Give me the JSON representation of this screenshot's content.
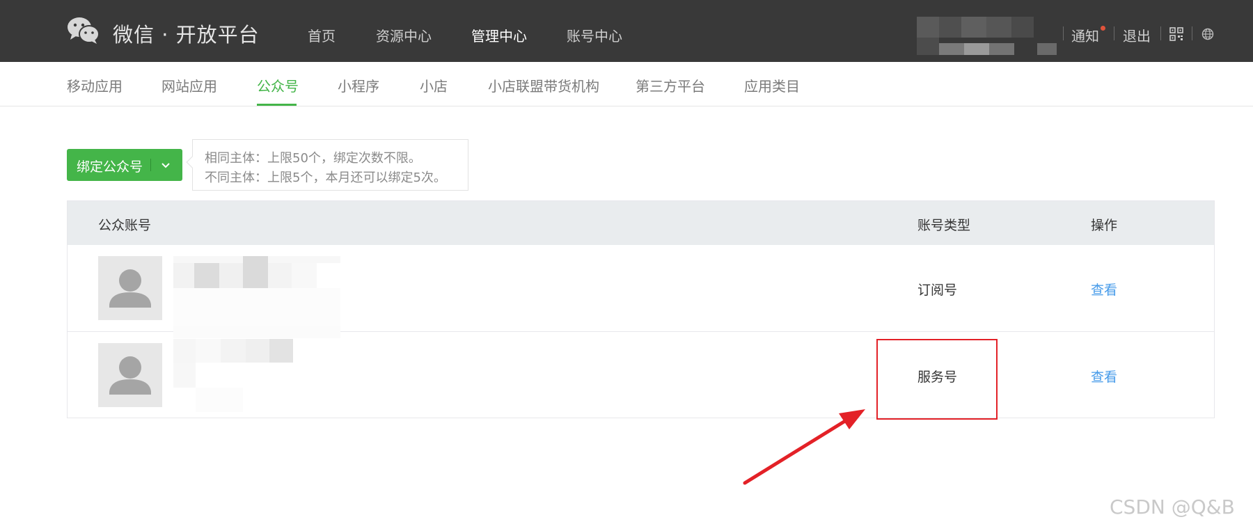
{
  "header": {
    "brand": "微信 · 开放平台",
    "nav": [
      {
        "label": "首页",
        "active": false
      },
      {
        "label": "资源中心",
        "active": false
      },
      {
        "label": "管理中心",
        "active": true
      },
      {
        "label": "账号中心",
        "active": false
      }
    ],
    "notice_label": "通知",
    "logout_label": "退出",
    "icons": [
      "wechat-logo-icon",
      "qrcode-icon",
      "globe-icon"
    ]
  },
  "subnav": {
    "items": [
      {
        "label": "移动应用",
        "active": false
      },
      {
        "label": "网站应用",
        "active": false
      },
      {
        "label": "公众号",
        "active": true
      },
      {
        "label": "小程序",
        "active": false
      },
      {
        "label": "小店",
        "active": false
      },
      {
        "label": "小店联盟带货机构",
        "active": false
      },
      {
        "label": "第三方平台",
        "active": false
      },
      {
        "label": "应用类目",
        "active": false
      }
    ]
  },
  "bind": {
    "button_label": "绑定公众号",
    "tip_line1": "相同主体：上限50个，绑定次数不限。",
    "tip_line2": "不同主体：上限5个，本月还可以绑定5次。"
  },
  "table": {
    "headers": {
      "account": "公众账号",
      "type": "账号类型",
      "action": "操作"
    },
    "rows": [
      {
        "type": "订阅号",
        "action": "查看"
      },
      {
        "type": "服务号",
        "action": "查看"
      }
    ]
  },
  "watermark": "CSDN @Q&B",
  "colors": {
    "topbar": "#393939",
    "accent_green": "#44b549",
    "link_blue": "#459ae9",
    "highlight_red": "#e32127"
  }
}
